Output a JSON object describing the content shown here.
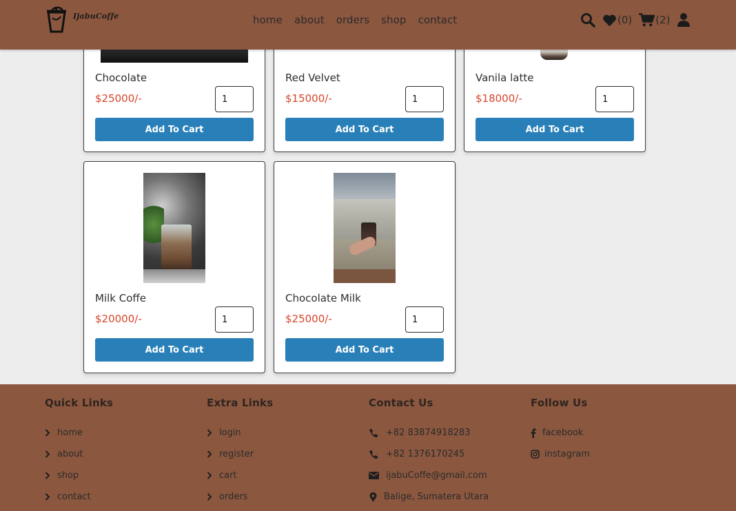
{
  "brand": {
    "name": "IjabuCoffe"
  },
  "nav": [
    {
      "label": "home"
    },
    {
      "label": "about"
    },
    {
      "label": "orders"
    },
    {
      "label": "shop"
    },
    {
      "label": "contact"
    }
  ],
  "header_icons": {
    "wishlist_count": "(0)",
    "cart_count": "(2)"
  },
  "products": [
    {
      "name": "Chocolate",
      "price": "$25000/-",
      "qty": "1",
      "button": "Add To Cart"
    },
    {
      "name": "Red Velvet",
      "price": "$15000/-",
      "qty": "1",
      "button": "Add To Cart"
    },
    {
      "name": "Vanila latte",
      "price": "$18000/-",
      "qty": "1",
      "button": "Add To Cart"
    },
    {
      "name": "Milk Coffe",
      "price": "$20000/-",
      "qty": "1",
      "button": "Add To Cart"
    },
    {
      "name": "Chocolate Milk",
      "price": "$25000/-",
      "qty": "1",
      "button": "Add To Cart"
    }
  ],
  "footer": {
    "quick_links": {
      "title": "Quick Links",
      "items": [
        "home",
        "about",
        "shop",
        "contact"
      ]
    },
    "extra_links": {
      "title": "Extra Links",
      "items": [
        "login",
        "register",
        "cart",
        "orders"
      ]
    },
    "contact": {
      "title": "Contact Us",
      "items": [
        "+82 83874918283",
        "+82 1376170245",
        "ijabuCoffe@gmail.com",
        "Balige, Sumatera Utara"
      ]
    },
    "follow": {
      "title": "Follow Us",
      "items": [
        "facebook",
        "instagram"
      ]
    }
  },
  "colors": {
    "brand_brown": "#8b573f",
    "accent_blue": "#2980b9",
    "price_red": "#d8442b",
    "background": "#eeeded"
  }
}
